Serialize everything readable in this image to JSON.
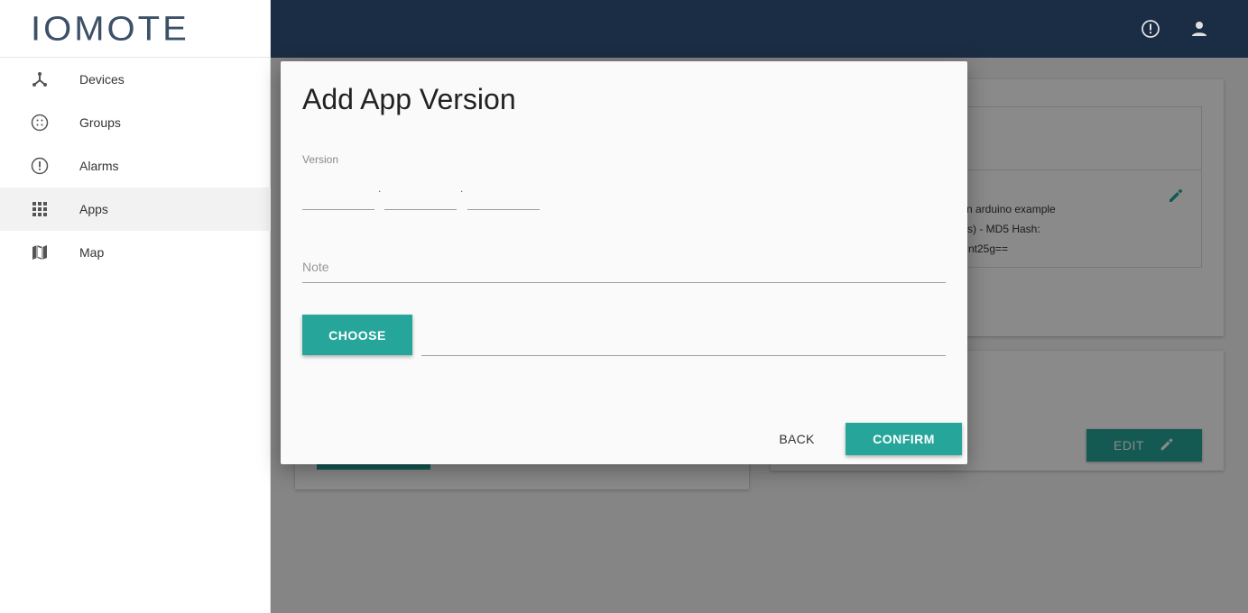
{
  "logo": {
    "text": "IOMOTE"
  },
  "sidebar": {
    "items": [
      {
        "label": "Devices",
        "icon": "devices-icon"
      },
      {
        "label": "Groups",
        "icon": "groups-icon"
      },
      {
        "label": "Alarms",
        "icon": "alarm-icon"
      },
      {
        "label": "Apps",
        "icon": "apps-grid-icon",
        "active": true
      },
      {
        "label": "Map",
        "icon": "map-icon"
      }
    ]
  },
  "topbar": {
    "icons": [
      "alert-icon",
      "account-icon"
    ]
  },
  "background": {
    "line1": "n arduino example",
    "line2": "s) - MD5 Hash:",
    "line3": "nt25g==",
    "edit_label": "EDIT"
  },
  "dialog": {
    "title": "Add App Version",
    "version_label": "Version",
    "version_dot": ".",
    "note_placeholder": "Note",
    "choose_label": "CHOOSE",
    "back_label": "BACK",
    "confirm_label": "CONFIRM"
  },
  "colors": {
    "accent": "#26a69a",
    "topbar": "#1b2d45",
    "logo": "#3c5068"
  }
}
